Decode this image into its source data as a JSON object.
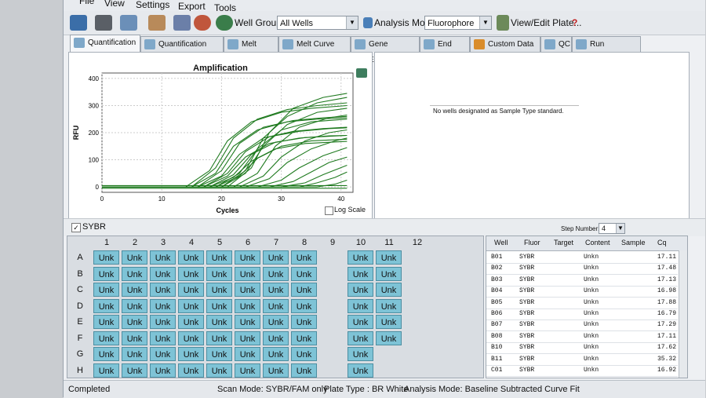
{
  "menu": [
    "File",
    "View",
    "Settings",
    "Export",
    "Tools"
  ],
  "toolbar": {
    "well_group_label": "Well Group:",
    "well_group_value": "All Wells",
    "analysis_mode_label": "Analysis Mode:",
    "analysis_mode_value": "Fluorophore",
    "view_edit_label": "View/Edit Plate...",
    "help_icon": "?"
  },
  "tabs": [
    "Quantification",
    "Quantification Data",
    "Melt Curve",
    "Melt Curve Data",
    "Gene Expression",
    "End Point",
    "Custom Data View",
    "QC",
    "Run Information"
  ],
  "chart": {
    "log_scale_label": "Log Scale"
  },
  "chart_data": {
    "type": "line",
    "title": "Amplification",
    "xlabel": "Cycles",
    "ylabel": "RFU",
    "xlim": [
      0,
      42
    ],
    "ylim": [
      -20,
      420
    ],
    "x_ticks": [
      0,
      10,
      20,
      30,
      40
    ],
    "y_ticks": [
      0,
      100,
      200,
      300,
      400
    ],
    "grid": true,
    "series_color": "#1f7a1f",
    "series": [
      {
        "values": [
          [
            0,
            0
          ],
          [
            14,
            0
          ],
          [
            18,
            60
          ],
          [
            21,
            170
          ],
          [
            25,
            240
          ],
          [
            30,
            275
          ],
          [
            35,
            290
          ],
          [
            41,
            300
          ]
        ]
      },
      {
        "values": [
          [
            0,
            0
          ],
          [
            15,
            0
          ],
          [
            19,
            70
          ],
          [
            22,
            180
          ],
          [
            26,
            250
          ],
          [
            31,
            285
          ],
          [
            36,
            300
          ],
          [
            41,
            310
          ]
        ]
      },
      {
        "values": [
          [
            0,
            0
          ],
          [
            15,
            0
          ],
          [
            19,
            50
          ],
          [
            22,
            150
          ],
          [
            26,
            210
          ],
          [
            31,
            240
          ],
          [
            36,
            250
          ],
          [
            41,
            255
          ]
        ]
      },
      {
        "values": [
          [
            0,
            0
          ],
          [
            16,
            0
          ],
          [
            20,
            60
          ],
          [
            23,
            160
          ],
          [
            27,
            220
          ],
          [
            32,
            245
          ],
          [
            37,
            255
          ],
          [
            41,
            260
          ]
        ]
      },
      {
        "values": [
          [
            0,
            0
          ],
          [
            16,
            0
          ],
          [
            20,
            40
          ],
          [
            23,
            120
          ],
          [
            27,
            180
          ],
          [
            32,
            205
          ],
          [
            37,
            215
          ],
          [
            41,
            220
          ]
        ]
      },
      {
        "values": [
          [
            0,
            0
          ],
          [
            17,
            0
          ],
          [
            21,
            50
          ],
          [
            24,
            130
          ],
          [
            28,
            185
          ],
          [
            33,
            205
          ],
          [
            38,
            215
          ],
          [
            41,
            218
          ]
        ]
      },
      {
        "values": [
          [
            0,
            0
          ],
          [
            17,
            0
          ],
          [
            21,
            40
          ],
          [
            24,
            110
          ],
          [
            28,
            160
          ],
          [
            33,
            180
          ],
          [
            38,
            188
          ],
          [
            41,
            190
          ]
        ]
      },
      {
        "values": [
          [
            0,
            0
          ],
          [
            18,
            0
          ],
          [
            22,
            45
          ],
          [
            25,
            120
          ],
          [
            29,
            165
          ],
          [
            34,
            182
          ],
          [
            41,
            190
          ]
        ]
      },
      {
        "values": [
          [
            0,
            0
          ],
          [
            18,
            0
          ],
          [
            22,
            35
          ],
          [
            25,
            95
          ],
          [
            29,
            140
          ],
          [
            34,
            160
          ],
          [
            41,
            168
          ]
        ]
      },
      {
        "values": [
          [
            0,
            0
          ],
          [
            19,
            0
          ],
          [
            23,
            40
          ],
          [
            26,
            105
          ],
          [
            30,
            150
          ],
          [
            35,
            170
          ],
          [
            41,
            176
          ]
        ]
      },
      {
        "values": [
          [
            0,
            0
          ],
          [
            19,
            0
          ],
          [
            23,
            50
          ],
          [
            26,
            140
          ],
          [
            30,
            210
          ],
          [
            35,
            240
          ],
          [
            41,
            250
          ]
        ]
      },
      {
        "values": [
          [
            0,
            0
          ],
          [
            20,
            0
          ],
          [
            24,
            50
          ],
          [
            27,
            150
          ],
          [
            31,
            230
          ],
          [
            36,
            275
          ],
          [
            41,
            290
          ]
        ]
      },
      {
        "values": [
          [
            0,
            0
          ],
          [
            20,
            0
          ],
          [
            24,
            60
          ],
          [
            27,
            180
          ],
          [
            31,
            260
          ],
          [
            36,
            310
          ],
          [
            41,
            330
          ]
        ]
      },
      {
        "values": [
          [
            0,
            0
          ],
          [
            21,
            0
          ],
          [
            25,
            70
          ],
          [
            28,
            200
          ],
          [
            32,
            290
          ],
          [
            37,
            330
          ],
          [
            41,
            345
          ]
        ]
      },
      {
        "values": [
          [
            0,
            0
          ],
          [
            22,
            0
          ],
          [
            26,
            50
          ],
          [
            29,
            150
          ],
          [
            33,
            220
          ],
          [
            38,
            255
          ],
          [
            41,
            265
          ]
        ]
      },
      {
        "values": [
          [
            0,
            0
          ],
          [
            23,
            0
          ],
          [
            27,
            40
          ],
          [
            30,
            110
          ],
          [
            34,
            170
          ],
          [
            38,
            200
          ],
          [
            41,
            210
          ]
        ]
      },
      {
        "values": [
          [
            0,
            0
          ],
          [
            24,
            0
          ],
          [
            28,
            30
          ],
          [
            31,
            90
          ],
          [
            35,
            140
          ],
          [
            39,
            170
          ],
          [
            41,
            180
          ]
        ]
      },
      {
        "values": [
          [
            0,
            0
          ],
          [
            26,
            0
          ],
          [
            30,
            25
          ],
          [
            33,
            70
          ],
          [
            37,
            115
          ],
          [
            41,
            145
          ]
        ]
      },
      {
        "values": [
          [
            0,
            0
          ],
          [
            28,
            0
          ],
          [
            32,
            20
          ],
          [
            35,
            55
          ],
          [
            38,
            90
          ],
          [
            41,
            110
          ]
        ]
      },
      {
        "values": [
          [
            0,
            0
          ],
          [
            30,
            0
          ],
          [
            34,
            15
          ],
          [
            37,
            45
          ],
          [
            41,
            80
          ]
        ]
      },
      {
        "values": [
          [
            0,
            0
          ],
          [
            33,
            0
          ],
          [
            36,
            15
          ],
          [
            39,
            35
          ],
          [
            41,
            55
          ]
        ]
      },
      {
        "values": [
          [
            0,
            0
          ],
          [
            36,
            0
          ],
          [
            39,
            10
          ],
          [
            41,
            25
          ]
        ]
      },
      {
        "values": [
          [
            0,
            5
          ],
          [
            41,
            5
          ]
        ]
      },
      {
        "values": [
          [
            0,
            -5
          ],
          [
            41,
            -5
          ]
        ]
      }
    ]
  },
  "right_panel": {
    "message": "No wells designated as Sample Type standard."
  },
  "fluor_bar": {
    "checkbox_label": "SYBR",
    "step_label": "Step Number:",
    "step_value": "4"
  },
  "plate": {
    "columns": [
      "1",
      "2",
      "3",
      "4",
      "5",
      "6",
      "7",
      "8",
      "9",
      "10",
      "11",
      "12"
    ],
    "rows": [
      {
        "label": "A",
        "wells": [
          "Unk",
          "Unk",
          "Unk",
          "Unk",
          "Unk",
          "Unk",
          "Unk",
          "Unk",
          "",
          "Unk",
          "Unk",
          ""
        ]
      },
      {
        "label": "B",
        "wells": [
          "Unk",
          "Unk",
          "Unk",
          "Unk",
          "Unk",
          "Unk",
          "Unk",
          "Unk",
          "",
          "Unk",
          "Unk",
          ""
        ]
      },
      {
        "label": "C",
        "wells": [
          "Unk",
          "Unk",
          "Unk",
          "Unk",
          "Unk",
          "Unk",
          "Unk",
          "Unk",
          "",
          "Unk",
          "Unk",
          ""
        ]
      },
      {
        "label": "D",
        "wells": [
          "Unk",
          "Unk",
          "Unk",
          "Unk",
          "Unk",
          "Unk",
          "Unk",
          "Unk",
          "",
          "Unk",
          "Unk",
          ""
        ]
      },
      {
        "label": "E",
        "wells": [
          "Unk",
          "Unk",
          "Unk",
          "Unk",
          "Unk",
          "Unk",
          "Unk",
          "Unk",
          "",
          "Unk",
          "Unk",
          ""
        ]
      },
      {
        "label": "F",
        "wells": [
          "Unk",
          "Unk",
          "Unk",
          "Unk",
          "Unk",
          "Unk",
          "Unk",
          "Unk",
          "",
          "Unk",
          "Unk",
          ""
        ]
      },
      {
        "label": "G",
        "wells": [
          "Unk",
          "Unk",
          "Unk",
          "Unk",
          "Unk",
          "Unk",
          "Unk",
          "Unk",
          "",
          "Unk",
          "",
          ""
        ]
      },
      {
        "label": "H",
        "wells": [
          "Unk",
          "Unk",
          "Unk",
          "Unk",
          "Unk",
          "Unk",
          "Unk",
          "Unk",
          "",
          "Unk",
          "",
          ""
        ]
      }
    ]
  },
  "table": {
    "headers": [
      "Well",
      "Fluor",
      "Target",
      "Content",
      "Sample",
      "Cq"
    ],
    "rows": [
      [
        "B01",
        "SYBR",
        "",
        "Unkn",
        "",
        "17.11"
      ],
      [
        "B02",
        "SYBR",
        "",
        "Unkn",
        "",
        "17.48"
      ],
      [
        "B03",
        "SYBR",
        "",
        "Unkn",
        "",
        "17.13"
      ],
      [
        "B04",
        "SYBR",
        "",
        "Unkn",
        "",
        "16.98"
      ],
      [
        "B05",
        "SYBR",
        "",
        "Unkn",
        "",
        "17.88"
      ],
      [
        "B06",
        "SYBR",
        "",
        "Unkn",
        "",
        "16.79"
      ],
      [
        "B07",
        "SYBR",
        "",
        "Unkn",
        "",
        "17.29"
      ],
      [
        "B08",
        "SYBR",
        "",
        "Unkn",
        "",
        "17.11"
      ],
      [
        "B10",
        "SYBR",
        "",
        "Unkn",
        "",
        "17.62"
      ],
      [
        "B11",
        "SYBR",
        "",
        "Unkn",
        "",
        "35.32"
      ],
      [
        "C01",
        "SYBR",
        "",
        "Unkn",
        "",
        "16.92"
      ]
    ]
  },
  "status": {
    "state": "Completed",
    "scan_mode": "Scan Mode: SYBR/FAM only",
    "plate_type": "Plate Type : BR White",
    "analysis_mode": "Analysis Mode: Baseline Subtracted Curve Fit"
  }
}
